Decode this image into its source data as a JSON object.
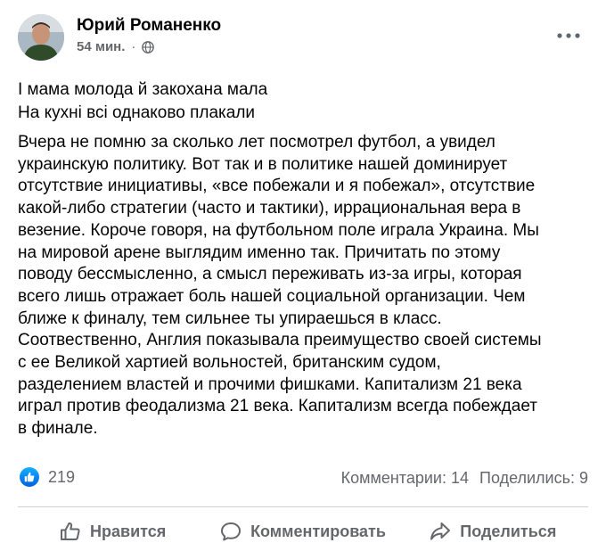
{
  "post": {
    "author": "Юрий Романенко",
    "time": "54 мин.",
    "separator": "·",
    "audience_icon": "globe-icon",
    "more_icon": "more-options-icon",
    "poem_lines": [
      "І мама молода й закохана мала",
      "На кухні всі однаково плакали"
    ],
    "body": "Вчера не помню за сколько лет посмотрел футбол, а увидел\nукраинскую политику. Вот так и в политике нашей доминирует\nотсутствие инициативы, «все побежали и я побежал», отсутствие\nкакой-либо стратегии (часто и тактики), иррациональная вера в\nвезение. Короче говоря, на футбольном поле играла Украина. Мы\nна мировой арене выглядим именно так. Причитать по этому\nповоду бессмысленно, а смысл  переживать из-за игры, которая\nвсего лишь отражает боль нашей социальной организации. Чем\nближе к финалу, тем сильнее ты упираешься в класс.\nСоотвественно, Англия показывала преимущество своей системы\nс ее  Великой хартией вольностей, британским судом,\nразделением властей и прочими фишками. Капитализм 21 века\nиграл против феодализма 21 века. Капитализм всегда побеждает\nв финале."
  },
  "stats": {
    "reaction_count": "219",
    "comments": "Комментарии: 14",
    "shares": "Поделились: 9"
  },
  "actions": {
    "like": "Нравится",
    "comment": "Комментировать",
    "share": "Поделиться"
  },
  "colors": {
    "text": "#050505",
    "secondary": "#65676b",
    "like_blue": "#0062df",
    "divider": "#ced0d4"
  }
}
